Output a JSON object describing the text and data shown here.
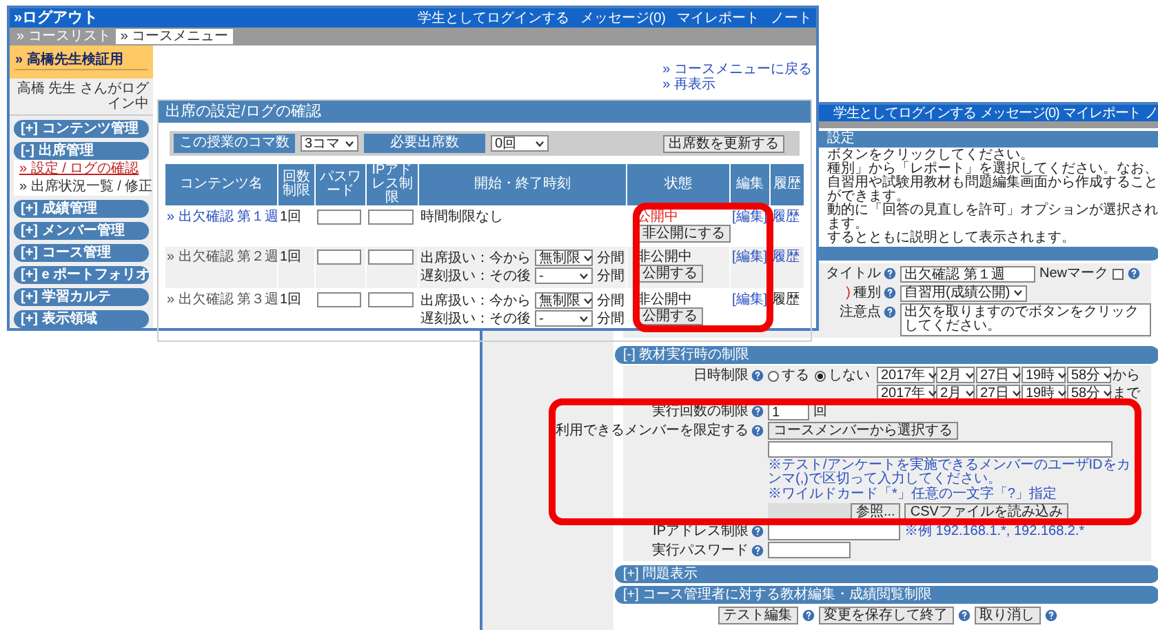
{
  "front_window": {
    "top_bar": {
      "logout": "»ログアウト",
      "links": [
        "学生としてログインする",
        "メッセージ(0)",
        "マイレポート",
        "ノート"
      ]
    },
    "breadcrumbs": [
      {
        "label": "» コースリスト",
        "selected": false
      },
      {
        "label": "» コースメニュー",
        "selected": true
      }
    ],
    "sidebar": {
      "course": "» 高橋先生検証用",
      "login_status": "高橋 先生 さんがログイン中",
      "menu": [
        {
          "label": "[+] コンテンツ管理"
        },
        {
          "label": "[-] 出席管理",
          "children": [
            {
              "label": "» 設定 / ログの確認",
              "selected": true
            },
            {
              "label": "» 出席状況一覧 / 修正",
              "selected": false
            }
          ]
        },
        {
          "label": "[+] 成績管理"
        },
        {
          "label": "[+] メンバー管理"
        },
        {
          "label": "[+] コース管理"
        },
        {
          "label": "[+] e ポートフォリオ"
        },
        {
          "label": "[+] 学習カルテ"
        },
        {
          "label": "[+] 表示領域"
        }
      ]
    },
    "links": [
      "» コースメニューに戻る",
      "» 再表示"
    ],
    "panel": {
      "title": "出席の設定/ログの確認",
      "settings": [
        {
          "label": "この授業のコマ数",
          "value": "3コマ"
        },
        {
          "label": "必要出席数",
          "value": "0回"
        }
      ],
      "update_button": "出席数を更新する",
      "columns": [
        "コンテンツ名",
        "回数制限",
        "パスワード",
        "IPアドレス制限",
        "開始・終了時刻",
        "状態",
        "編集",
        "履歴"
      ],
      "rows": [
        {
          "name": "» 出欠確認 第１週",
          "published": true,
          "limit": "1回",
          "time": {
            "kind": "none",
            "text": "時間制限なし"
          },
          "status": "公開中",
          "toggle": "非公開にする",
          "edit": "[編集]",
          "history": "履歴",
          "history_link": true
        },
        {
          "name": "» 出欠確認 第２週",
          "published": false,
          "limit": "1回",
          "time": {
            "kind": "limits",
            "entries": [
              {
                "caption": "出席扱い：今から",
                "selection": "無制限",
                "unit": "分間"
              },
              {
                "caption": "遅刻扱い：その後",
                "selection": "-",
                "unit": "分間"
              }
            ]
          },
          "status": "非公開中",
          "toggle": "公開する",
          "edit": "[編集]",
          "history": "履歴",
          "history_link": true
        },
        {
          "name": "» 出欠確認 第３週",
          "published": false,
          "limit": "1回",
          "time": {
            "kind": "limits",
            "entries": [
              {
                "caption": "出席扱い：今から",
                "selection": "無制限",
                "unit": "分間"
              },
              {
                "caption": "遅刻扱い：その後",
                "selection": "-",
                "unit": "分間"
              }
            ]
          },
          "status": "非公開中",
          "toggle": "公開する",
          "edit": "[編集]",
          "history": "履歴",
          "history_link": false
        }
      ]
    }
  },
  "back_window": {
    "top_bar": {
      "links": [
        "学生としてログインする",
        "メッセージ(0)",
        "マイレポート",
        "ノ"
      ]
    },
    "header": "設定",
    "instructions": [
      "ボタンをクリックしてください。",
      "種別」から「レポート」を選択してください。なお、自習用や試験用教材も問題編集画面から作成することができます。",
      "動的に「回答の見直しを許可」オプションが選択されます。",
      "するとともに説明として表示されます。"
    ],
    "title_field": {
      "label": "タイトル",
      "value": "出欠確認 第１週"
    },
    "new_mark": {
      "label": "Newマーク",
      "checked": false
    },
    "type_field": {
      "prefix": ")",
      "label": "種別",
      "value": "自習用(成績公開)"
    },
    "notes_field": {
      "label": "注意点",
      "value": "出欠を取りますのでボタンをクリックしてください。"
    },
    "restrictions": {
      "title": "[-] 教材実行時の制限",
      "schedule": {
        "label": "日時制限",
        "options": [
          {
            "label": "する",
            "selected": false
          },
          {
            "label": "しない",
            "selected": true
          }
        ],
        "rows": [
          {
            "values": [
              "2017年",
              "2月",
              "27日",
              "19時",
              "58分"
            ],
            "suffix": "から"
          },
          {
            "values": [
              "2017年",
              "2月",
              "27日",
              "19時",
              "58分"
            ],
            "suffix": "まで"
          }
        ]
      },
      "attempts": {
        "label": "実行回数の制限",
        "value": "1",
        "unit": "回"
      },
      "members": {
        "label": "利用できるメンバーを限定する",
        "button": "コースメンバーから選択する",
        "notes": [
          "※テスト/アンケートを実施できるメンバーのユーザIDをカンマ(,)で区切って入力してください。",
          "※ワイルドカード「*」任意の一文字「?」指定"
        ],
        "browse_button": "参照...",
        "csv_button": "CSVファイルを読み込み"
      },
      "ip": {
        "label": "IPアドレス制限",
        "example": "※例 192.168.1.*, 192.168.2.*"
      },
      "password": {
        "label": "実行パスワード"
      }
    },
    "sections": [
      "[+] 問題表示",
      "[+] コース管理者に対する教材編集・成績閲覧制限"
    ],
    "buttons": [
      {
        "label": "テスト編集"
      },
      {
        "label": "変更を保存して終了"
      },
      {
        "label": "取り消し"
      }
    ]
  }
}
